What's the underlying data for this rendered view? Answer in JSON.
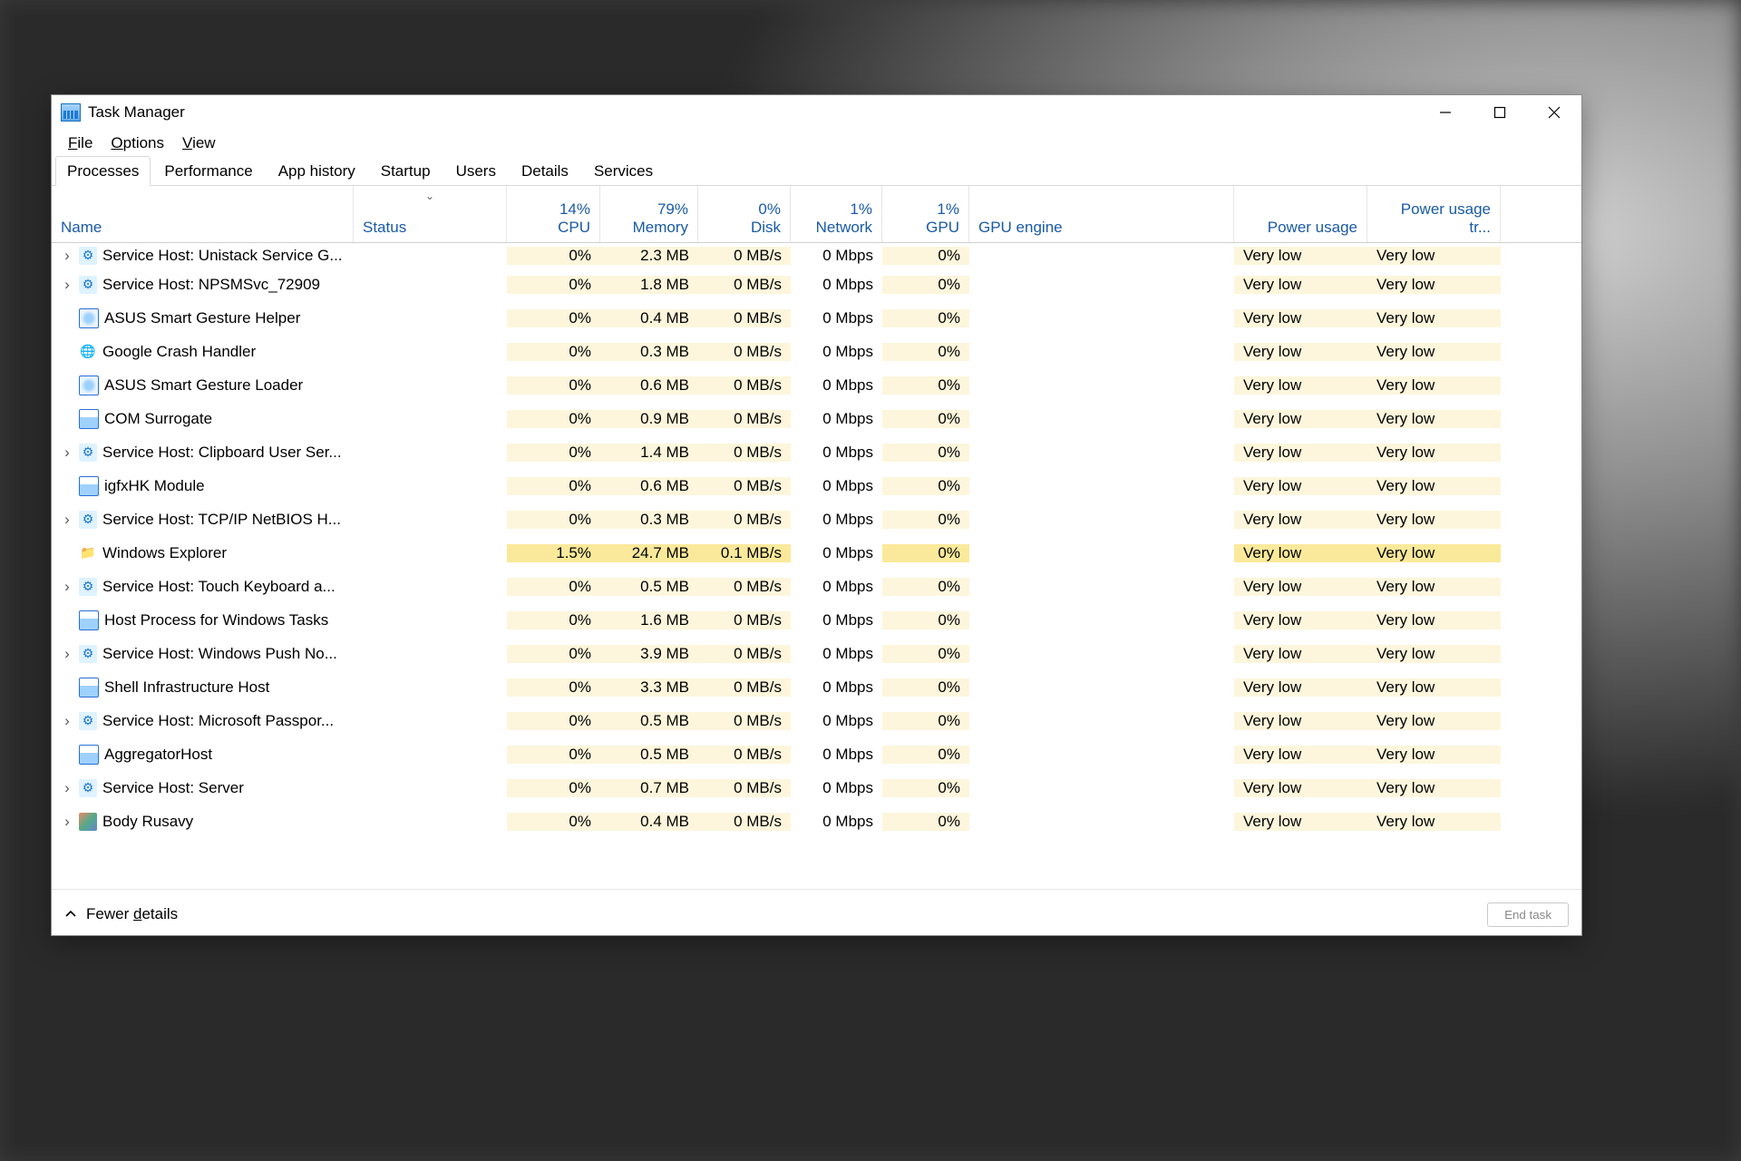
{
  "window": {
    "title": "Task Manager"
  },
  "menubar": [
    "File",
    "Options",
    "View"
  ],
  "tabs": [
    "Processes",
    "Performance",
    "App history",
    "Startup",
    "Users",
    "Details",
    "Services"
  ],
  "active_tab": "Processes",
  "header": {
    "name": "Name",
    "status": "Status",
    "cpu": {
      "label": "CPU",
      "value": "14%"
    },
    "memory": {
      "label": "Memory",
      "value": "79%"
    },
    "disk": {
      "label": "Disk",
      "value": "0%"
    },
    "network": {
      "label": "Network",
      "value": "1%"
    },
    "gpu": {
      "label": "GPU",
      "value": "1%"
    },
    "gpu_engine": "GPU engine",
    "power": "Power usage",
    "power_trend": "Power usage tr..."
  },
  "footer": {
    "fewer": "Fewer details",
    "end_task": "End task"
  },
  "rows": [
    {
      "exp": true,
      "icon": "gear",
      "name": "Service Host: Unistack Service G...",
      "cpu": "0%",
      "mem": "2.3 MB",
      "disk": "0 MB/s",
      "net": "0 Mbps",
      "gpu": "0%",
      "power": "Very low",
      "powertr": "Very low",
      "row_height": "27"
    },
    {
      "exp": true,
      "icon": "gear",
      "name": "Service Host: NPSMSvc_72909",
      "cpu": "0%",
      "mem": "1.8 MB",
      "disk": "0 MB/s",
      "net": "0 Mbps",
      "gpu": "0%",
      "power": "Very low",
      "powertr": "Very low"
    },
    {
      "exp": false,
      "icon": "box",
      "name": "ASUS Smart Gesture Helper",
      "cpu": "0%",
      "mem": "0.4 MB",
      "disk": "0 MB/s",
      "net": "0 Mbps",
      "gpu": "0%",
      "power": "Very low",
      "powertr": "Very low"
    },
    {
      "exp": false,
      "icon": "globe",
      "name": "Google Crash Handler",
      "cpu": "0%",
      "mem": "0.3 MB",
      "disk": "0 MB/s",
      "net": "0 Mbps",
      "gpu": "0%",
      "power": "Very low",
      "powertr": "Very low"
    },
    {
      "exp": false,
      "icon": "box",
      "name": "ASUS Smart Gesture Loader",
      "cpu": "0%",
      "mem": "0.6 MB",
      "disk": "0 MB/s",
      "net": "0 Mbps",
      "gpu": "0%",
      "power": "Very low",
      "powertr": "Very low"
    },
    {
      "exp": false,
      "icon": "win",
      "name": "COM Surrogate",
      "cpu": "0%",
      "mem": "0.9 MB",
      "disk": "0 MB/s",
      "net": "0 Mbps",
      "gpu": "0%",
      "power": "Very low",
      "powertr": "Very low"
    },
    {
      "exp": true,
      "icon": "gear",
      "name": "Service Host: Clipboard User Ser...",
      "cpu": "0%",
      "mem": "1.4 MB",
      "disk": "0 MB/s",
      "net": "0 Mbps",
      "gpu": "0%",
      "power": "Very low",
      "powertr": "Very low"
    },
    {
      "exp": false,
      "icon": "win",
      "name": "igfxHK Module",
      "cpu": "0%",
      "mem": "0.6 MB",
      "disk": "0 MB/s",
      "net": "0 Mbps",
      "gpu": "0%",
      "power": "Very low",
      "powertr": "Very low"
    },
    {
      "exp": true,
      "icon": "gear",
      "name": "Service Host: TCP/IP NetBIOS H...",
      "cpu": "0%",
      "mem": "0.3 MB",
      "disk": "0 MB/s",
      "net": "0 Mbps",
      "gpu": "0%",
      "power": "Very low",
      "powertr": "Very low"
    },
    {
      "exp": false,
      "icon": "folder",
      "name": "Windows Explorer",
      "cpu": "1.5%",
      "mem": "24.7 MB",
      "disk": "0.1 MB/s",
      "net": "0 Mbps",
      "gpu": "0%",
      "power": "Very low",
      "powertr": "Very low",
      "heat": "mid"
    },
    {
      "exp": true,
      "icon": "gear",
      "name": "Service Host: Touch Keyboard a...",
      "cpu": "0%",
      "mem": "0.5 MB",
      "disk": "0 MB/s",
      "net": "0 Mbps",
      "gpu": "0%",
      "power": "Very low",
      "powertr": "Very low"
    },
    {
      "exp": false,
      "icon": "win",
      "name": "Host Process for Windows Tasks",
      "cpu": "0%",
      "mem": "1.6 MB",
      "disk": "0 MB/s",
      "net": "0 Mbps",
      "gpu": "0%",
      "power": "Very low",
      "powertr": "Very low"
    },
    {
      "exp": true,
      "icon": "gear",
      "name": "Service Host: Windows Push No...",
      "cpu": "0%",
      "mem": "3.9 MB",
      "disk": "0 MB/s",
      "net": "0 Mbps",
      "gpu": "0%",
      "power": "Very low",
      "powertr": "Very low"
    },
    {
      "exp": false,
      "icon": "win",
      "name": "Shell Infrastructure Host",
      "cpu": "0%",
      "mem": "3.3 MB",
      "disk": "0 MB/s",
      "net": "0 Mbps",
      "gpu": "0%",
      "power": "Very low",
      "powertr": "Very low"
    },
    {
      "exp": true,
      "icon": "gear",
      "name": "Service Host: Microsoft Passpor...",
      "cpu": "0%",
      "mem": "0.5 MB",
      "disk": "0 MB/s",
      "net": "0 Mbps",
      "gpu": "0%",
      "power": "Very low",
      "powertr": "Very low"
    },
    {
      "exp": false,
      "icon": "win",
      "name": "AggregatorHost",
      "cpu": "0%",
      "mem": "0.5 MB",
      "disk": "0 MB/s",
      "net": "0 Mbps",
      "gpu": "0%",
      "power": "Very low",
      "powertr": "Very low"
    },
    {
      "exp": true,
      "icon": "gear",
      "name": "Service Host: Server",
      "cpu": "0%",
      "mem": "0.7 MB",
      "disk": "0 MB/s",
      "net": "0 Mbps",
      "gpu": "0%",
      "power": "Very low",
      "powertr": "Very low"
    },
    {
      "exp": true,
      "icon": "body",
      "name": "Body Rusavy",
      "cpu": "0%",
      "mem": "0.4 MB",
      "disk": "0 MB/s",
      "net": "0 Mbps",
      "gpu": "0%",
      "power": "Very low",
      "powertr": "Very low"
    }
  ]
}
